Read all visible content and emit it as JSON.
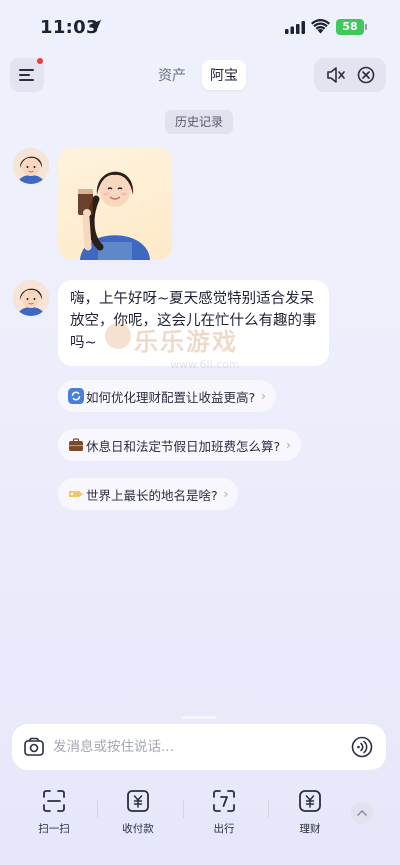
{
  "status_bar": {
    "time": "11:03",
    "battery": "58"
  },
  "header": {
    "tabs": [
      {
        "label": "资产",
        "active": false
      },
      {
        "label": "阿宝",
        "active": true
      }
    ]
  },
  "history_label": "历史记录",
  "assistant_message": "嗨，上午好呀~夏天感觉特别适合发呆放空，你呢，这会儿在忙什么有趣的事吗~",
  "suggestions": [
    {
      "icon": "refresh-icon",
      "text": "如何优化理财配置让收益更高?"
    },
    {
      "icon": "briefcase-icon",
      "text": "休息日和法定节假日加班费怎么算?"
    },
    {
      "icon": "tag-icon",
      "text": "世界上最长的地名是啥?"
    }
  ],
  "watermark": {
    "main": "乐乐游戏",
    "sub": "www.6ll.com"
  },
  "input": {
    "placeholder": "发消息或按住说话..."
  },
  "bottom_nav": [
    {
      "icon": "scan-icon",
      "label": "扫一扫"
    },
    {
      "icon": "payment-code-icon",
      "label": "收付款"
    },
    {
      "icon": "travel-code-icon",
      "label": "出行"
    },
    {
      "icon": "wealth-icon",
      "label": "理财"
    }
  ],
  "colors": {
    "notification_dot": "#ef3b3b",
    "battery": "#3ec95a",
    "background": "#eceefb"
  }
}
